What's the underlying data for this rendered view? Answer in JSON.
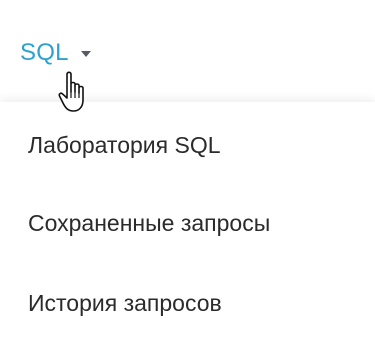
{
  "nav": {
    "label": "SQL",
    "caret_icon": "caret-down-icon"
  },
  "cursor_icon": "hand-pointer-cursor-icon",
  "menu": {
    "items": [
      {
        "label": "Лаборатория SQL"
      },
      {
        "label": "Сохраненные запросы"
      },
      {
        "label": "История запросов"
      }
    ]
  },
  "colors": {
    "accent": "#2ea1d1",
    "text": "#2b2b2b",
    "caret": "#555b63"
  }
}
